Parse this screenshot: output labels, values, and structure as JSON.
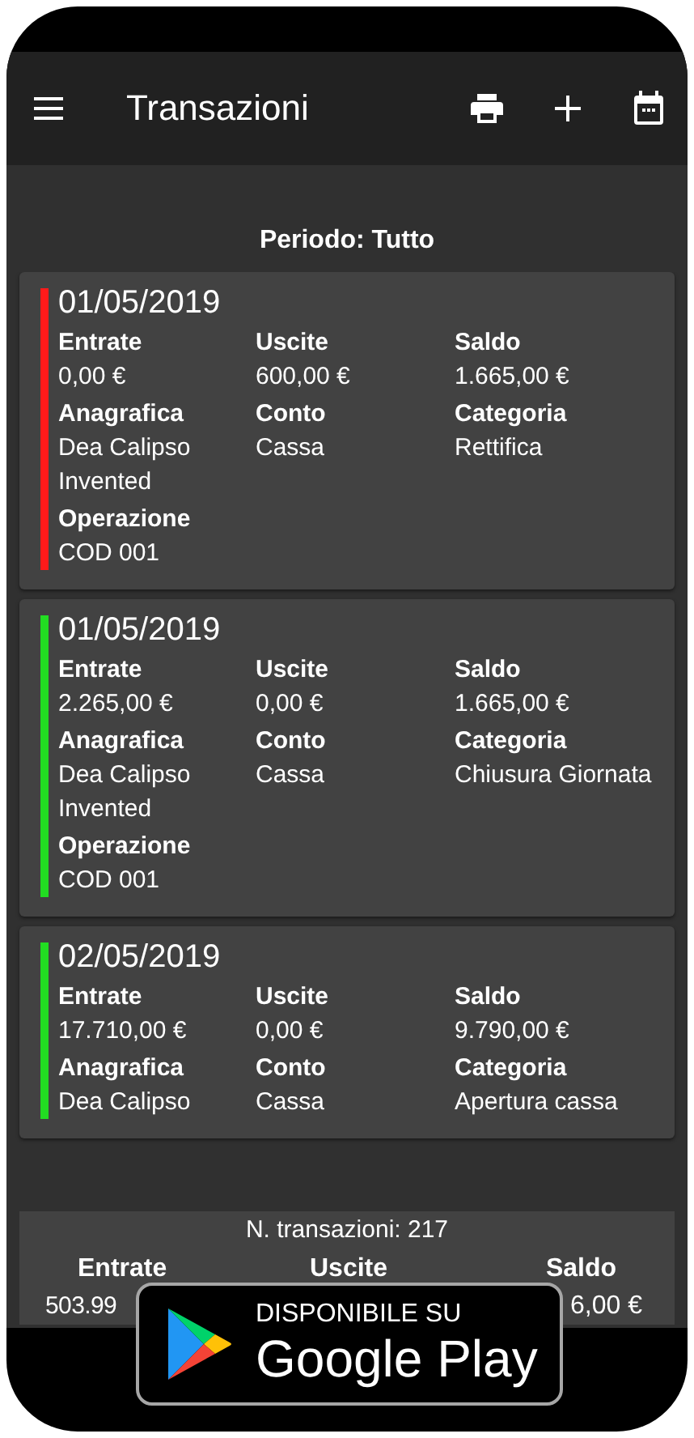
{
  "app_bar": {
    "title": "Transazioni"
  },
  "period": "Periodo: Tutto",
  "transactions": [
    {
      "date": "01/05/2019",
      "color": "#ff1a1a",
      "fields": [
        {
          "label": "Entrate",
          "value": "0,00 €"
        },
        {
          "label": "Uscite",
          "value": "600,00 €"
        },
        {
          "label": "Saldo",
          "value": "1.665,00 €"
        },
        {
          "label": "Anagrafica",
          "value": "Dea Calipso Invented"
        },
        {
          "label": "Conto",
          "value": "Cassa"
        },
        {
          "label": "Categoria",
          "value": "Rettifica"
        },
        {
          "label": "Operazione",
          "value": "COD 001"
        }
      ]
    },
    {
      "date": "01/05/2019",
      "color": "#22dd22",
      "fields": [
        {
          "label": "Entrate",
          "value": "2.265,00 €"
        },
        {
          "label": "Uscite",
          "value": "0,00 €"
        },
        {
          "label": "Saldo",
          "value": "1.665,00 €"
        },
        {
          "label": "Anagrafica",
          "value": "Dea Calipso Invented"
        },
        {
          "label": "Conto",
          "value": "Cassa"
        },
        {
          "label": "Categoria",
          "value": "Chiusura Giornata"
        },
        {
          "label": "Operazione",
          "value": "COD 001"
        }
      ]
    },
    {
      "date": "02/05/2019",
      "color": "#22dd22",
      "fields": [
        {
          "label": "Entrate",
          "value": "17.710,00 €"
        },
        {
          "label": "Uscite",
          "value": "0,00 €"
        },
        {
          "label": "Saldo",
          "value": "9.790,00 €"
        },
        {
          "label": "Anagrafica",
          "value": "Dea Calipso"
        },
        {
          "label": "Conto",
          "value": "Cassa"
        },
        {
          "label": "Categoria",
          "value": "Apertura cassa"
        }
      ]
    }
  ],
  "summary": {
    "count": "N. transazioni: 217",
    "totals": [
      {
        "label": "Entrate",
        "value": "503.99"
      },
      {
        "label": "Uscite"
      },
      {
        "label": "Saldo",
        "value": "6,00 €"
      }
    ]
  },
  "store_badge": {
    "caption": "DISPONIBILE SU",
    "store": "Google Play"
  }
}
